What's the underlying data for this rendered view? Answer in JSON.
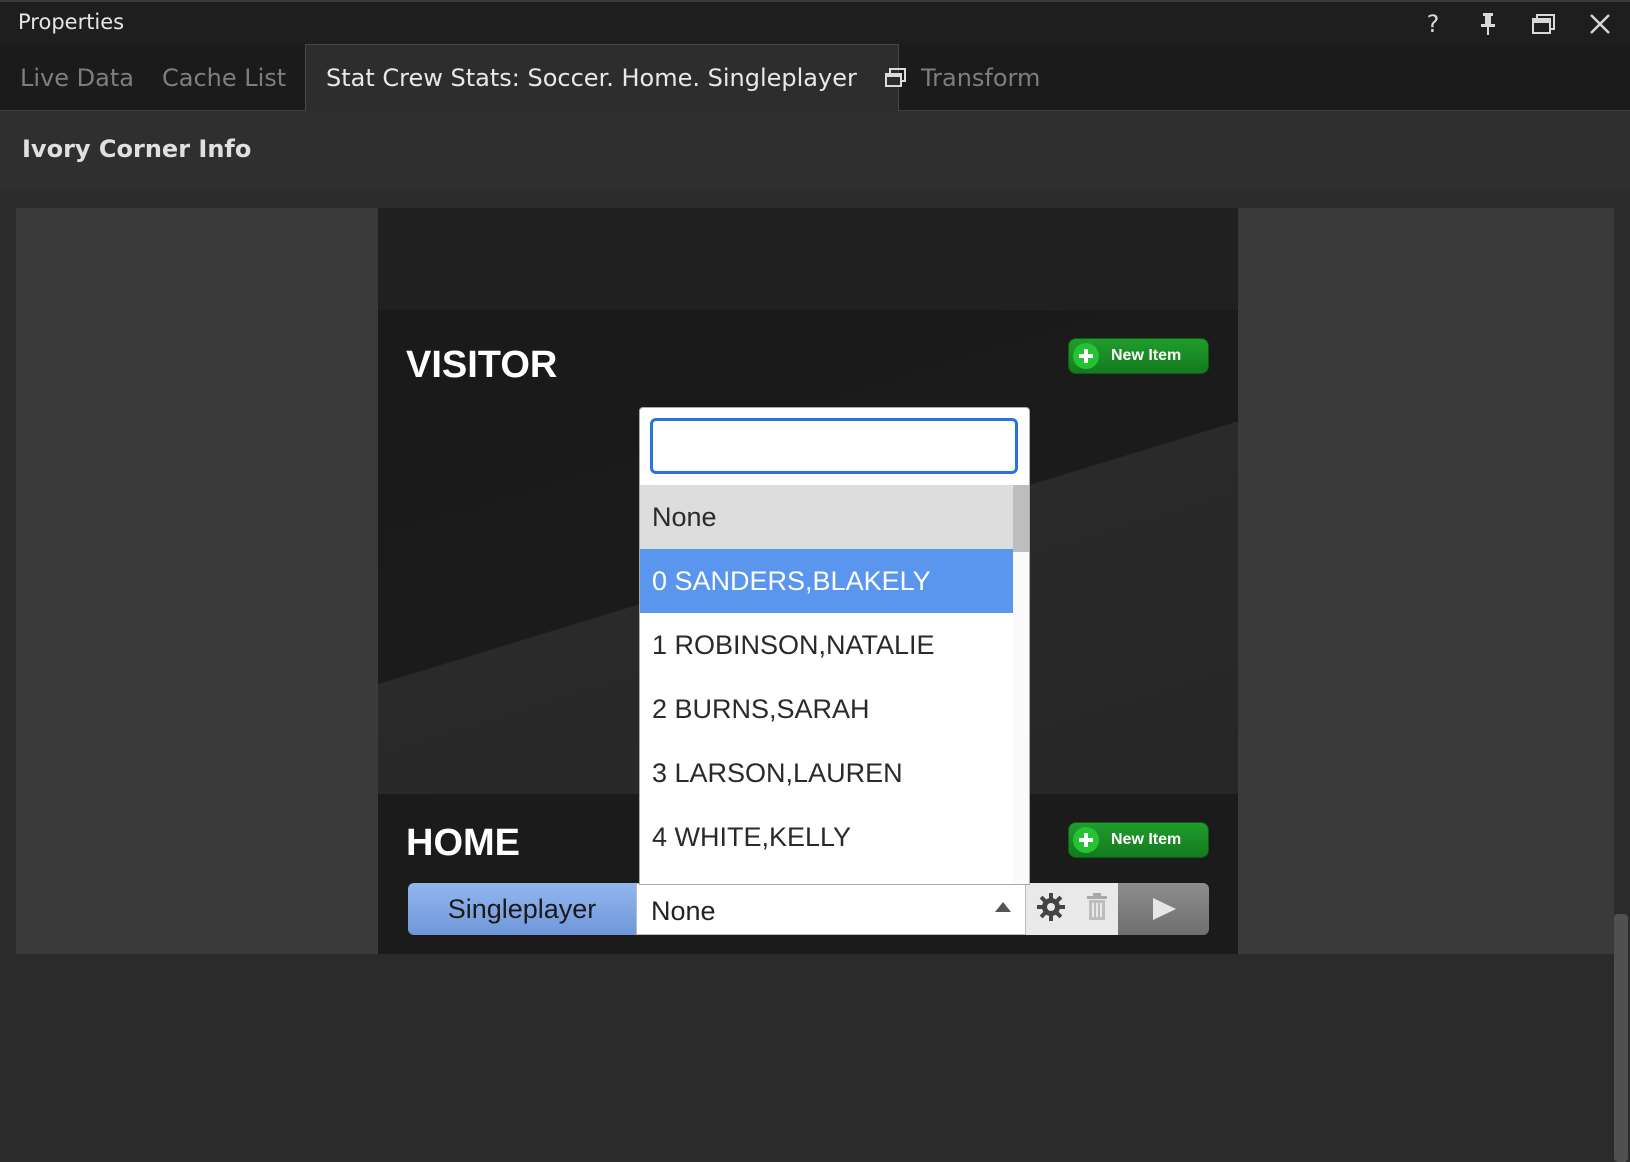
{
  "window": {
    "title": "Properties",
    "controls": [
      "help-icon",
      "pin-icon",
      "restore-icon",
      "close-icon"
    ],
    "help_label": "?"
  },
  "tabs": [
    {
      "label": "Live Data",
      "active": false
    },
    {
      "label": "Cache List",
      "active": false
    },
    {
      "label": "Stat Crew Stats: Soccer. Home. Singleplayer",
      "active": true
    },
    {
      "label": "Transform",
      "active": false
    }
  ],
  "section": {
    "title": "Ivory Corner Info"
  },
  "visitor": {
    "title": "VISITOR",
    "new_item_label": "New Item"
  },
  "home": {
    "title": "HOME",
    "new_item_label": "New Item",
    "mode_label": "Singleplayer",
    "selected_value": "None"
  },
  "dropdown": {
    "search_value": "",
    "options": [
      "None",
      "0 SANDERS,BLAKELY",
      "1 ROBINSON,NATALIE",
      "2 BURNS,SARAH",
      "3 LARSON,LAUREN",
      "4 WHITE,KELLY"
    ],
    "selected_index": 0,
    "highlighted_index": 1
  },
  "colors": {
    "accent_blue": "#5a95ee",
    "focus_blue": "#2a74d8",
    "new_item_green": "#1f9d2c"
  }
}
